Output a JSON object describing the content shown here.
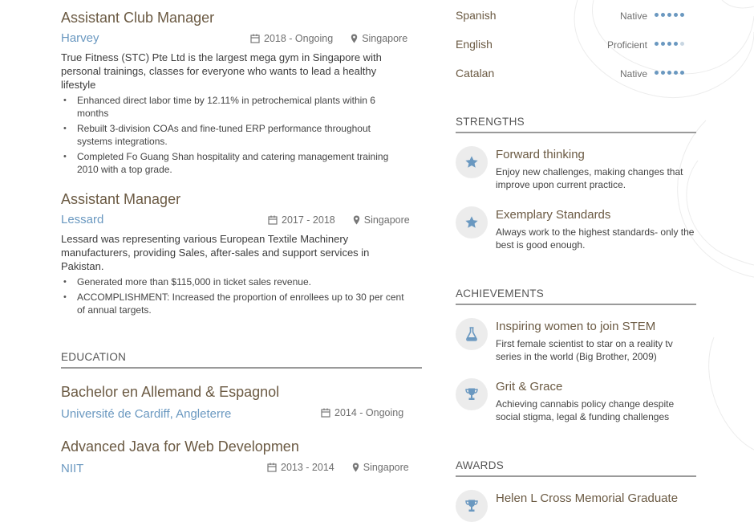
{
  "experience": [
    {
      "title": "Assistant Club Manager",
      "company": "Harvey",
      "date": "2018 - Ongoing",
      "location": "Singapore",
      "description": "True Fitness (STC) Pte Ltd is the largest mega gym in Singapore with personal trainings, classes for everyone who wants to lead a healthy lifestyle",
      "bullets": [
        "Enhanced direct labor time by 12.11% in petrochemical plants within 6 months",
        "Rebuilt 3-division COAs and fine-tuned ERP performance throughout systems integrations.",
        "Completed Fo Guang Shan hospitality and catering management training 2010 with a top grade."
      ]
    },
    {
      "title": "Assistant Manager",
      "company": "Lessard",
      "date": "2017 - 2018",
      "location": "Singapore",
      "description": "Lessard was representing various European Textile Machinery manufacturers, providing Sales, after-sales and support services in Pakistan.",
      "bullets": [
        "Generated more than $115,000 in ticket sales revenue.",
        "ACCOMPLISHMENT: Increased the proportion of enrollees up to 30 per cent of annual targets."
      ]
    }
  ],
  "education_heading": "EDUCATION",
  "education": [
    {
      "degree": "Bachelor en Allemand & Espagnol",
      "school": "Université de Cardiff, Angleterre",
      "date": "2014 - Ongoing",
      "location": ""
    },
    {
      "degree": "Advanced Java for Web Developmen",
      "school": "NIIT",
      "date": "2013 - 2014",
      "location": "Singapore"
    }
  ],
  "languages": [
    {
      "name": "Spanish",
      "level": "Native",
      "dots_filled": 5,
      "dots_total": 5
    },
    {
      "name": "English",
      "level": "Proficient",
      "dots_filled": 4,
      "dots_total": 5
    },
    {
      "name": "Catalan",
      "level": "Native",
      "dots_filled": 5,
      "dots_total": 5
    }
  ],
  "strengths_heading": "STRENGTHS",
  "strengths": [
    {
      "icon": "star-icon",
      "title": "Forward thinking",
      "desc": "Enjoy new challenges, making changes that improve upon current practice."
    },
    {
      "icon": "star-icon",
      "title": "Exemplary Standards",
      "desc": "Always work to the highest standards- only the best is good enough."
    }
  ],
  "achievements_heading": "ACHIEVEMENTS",
  "achievements": [
    {
      "icon": "flask-icon",
      "title": "Inspiring women to join STEM",
      "desc": "First female scientist to star on a reality tv series in the world (Big Brother, 2009)"
    },
    {
      "icon": "trophy-icon",
      "title": "Grit & Grace",
      "desc": "Achieving cannabis policy change despite social stigma, legal & funding challenges"
    }
  ],
  "awards_heading": "AWARDS",
  "awards": [
    {
      "icon": "trophy-icon",
      "title": "Helen L Cross Memorial Graduate"
    }
  ],
  "colors": {
    "accent_blue": "#6a98c0",
    "title_brown": "#6b5a43",
    "icon_circle": "#ececec"
  }
}
